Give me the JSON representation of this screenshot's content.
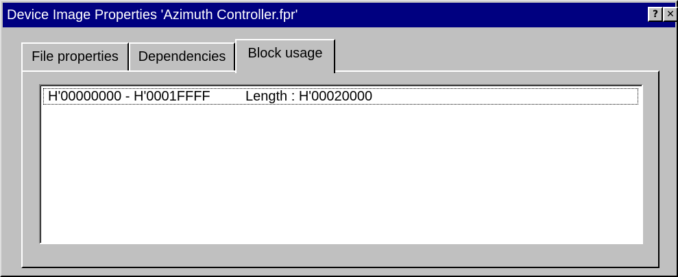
{
  "window": {
    "title": "Device Image Properties 'Azimuth Controller.fpr'",
    "help_button": "?",
    "close_button": "✕"
  },
  "tabs": [
    {
      "label": "File properties",
      "active": false
    },
    {
      "label": "Dependencies",
      "active": false
    },
    {
      "label": "Block usage",
      "active": true
    }
  ],
  "block_usage": {
    "rows": [
      {
        "range": "H'00000000 - H'0001FFFF",
        "length": "Length : H'00020000",
        "selected": true
      }
    ]
  },
  "colors": {
    "titlebar": "#000080",
    "face": "#c0c0c0",
    "list_background": "#ffffff"
  }
}
